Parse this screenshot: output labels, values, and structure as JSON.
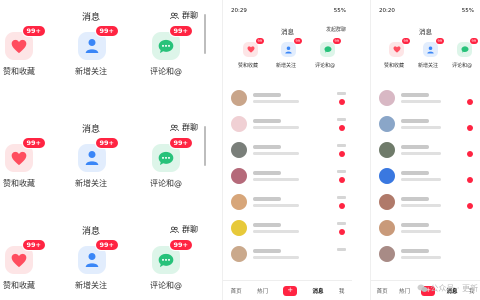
{
  "left_panel": {
    "title": "消息",
    "group_chat": "群聊",
    "tiles": [
      {
        "label": "赞和收藏",
        "badge": "99+",
        "icon": "heart-icon"
      },
      {
        "label": "新增关注",
        "badge": "99+",
        "icon": "person-icon"
      },
      {
        "label": "评论和@",
        "badge": "99+",
        "icon": "chat-bubble-icon"
      }
    ]
  },
  "phone1": {
    "status_time": "20:29",
    "status_right": "55%",
    "title": "消息",
    "group_chat": "发起群聊",
    "tiles": [
      {
        "label": "赞和收藏",
        "badge": "99"
      },
      {
        "label": "新增关注",
        "badge": "99"
      },
      {
        "label": "评论和@",
        "badge": "99"
      }
    ],
    "tabs": [
      "首页",
      "热门",
      "+",
      "消息",
      "我"
    ]
  },
  "phone2": {
    "status_time": "20:20",
    "status_right": "55%",
    "title": "消息",
    "tiles": [
      {
        "label": "赞和收藏",
        "badge": "99"
      },
      {
        "label": "新增关注",
        "badge": "99"
      },
      {
        "label": "评论和@",
        "badge": "99"
      }
    ],
    "tabs": [
      "首页",
      "热门",
      "+",
      "消息",
      "我"
    ]
  },
  "watermark": "公众号 · 更新"
}
